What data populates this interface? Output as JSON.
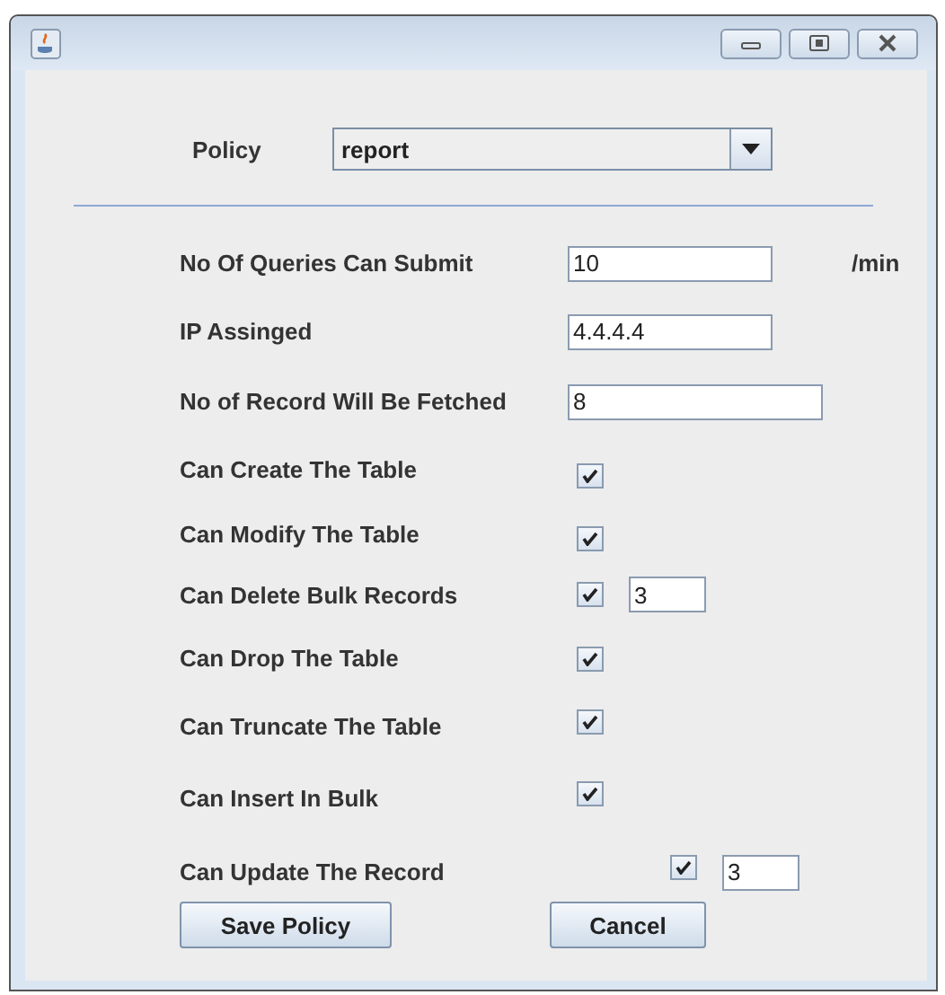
{
  "policy": {
    "label": "Policy",
    "value": "report"
  },
  "fields": [
    {
      "kind": "text",
      "label": "No Of Queries Can Submit",
      "value": "10",
      "unit": "/min"
    },
    {
      "kind": "text",
      "label": "IP Assinged",
      "value": "4.4.4.4"
    },
    {
      "kind": "text",
      "label": "No of Record Will Be Fetched",
      "value": "8"
    },
    {
      "kind": "check",
      "label": "Can Create The Table",
      "checked": true
    },
    {
      "kind": "check",
      "label": "Can Modify The Table",
      "checked": true
    },
    {
      "kind": "check",
      "label": "Can Delete Bulk Records",
      "checked": true,
      "count": "3"
    },
    {
      "kind": "check",
      "label": "Can Drop The Table",
      "checked": true
    },
    {
      "kind": "check",
      "label": "Can Truncate The Table",
      "checked": true
    },
    {
      "kind": "check",
      "label": "Can Insert In Bulk",
      "checked": true
    },
    {
      "kind": "check",
      "label": "Can Update The Record",
      "checked": true,
      "count": "3"
    }
  ],
  "buttons": [
    "Save Policy",
    "Cancel"
  ]
}
